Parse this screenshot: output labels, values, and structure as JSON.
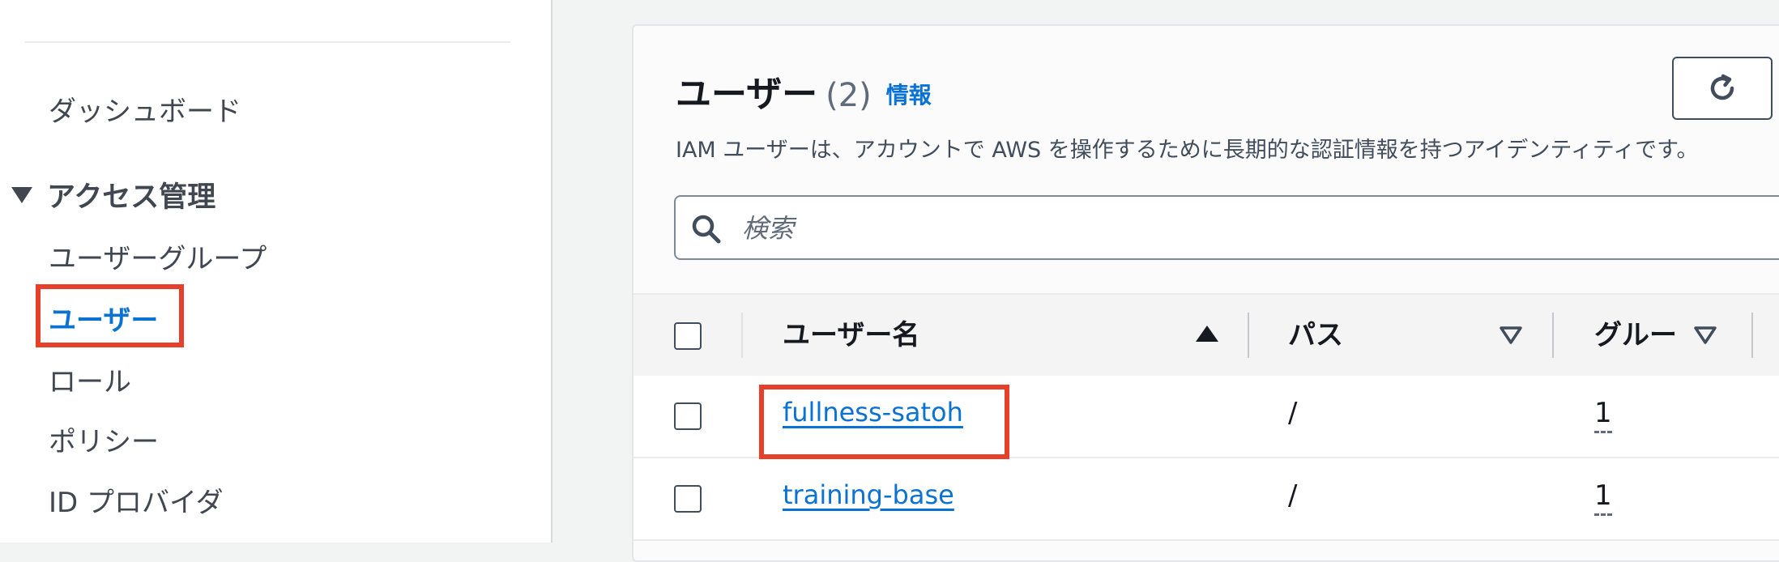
{
  "sidebar": {
    "dashboard": "ダッシュボード",
    "access_section": "アクセス管理",
    "items": [
      {
        "label": "ユーザーグループ"
      },
      {
        "label": "ユーザー"
      },
      {
        "label": "ロール"
      },
      {
        "label": "ポリシー"
      },
      {
        "label": "ID プロバイダ"
      }
    ],
    "active_item": "ユーザー"
  },
  "header": {
    "title": "ユーザー",
    "count": "(2)",
    "info_link": "情報",
    "description": "IAM ユーザーは、アカウントで AWS を操作するために長期的な認証情報を持つアイデンティティです。"
  },
  "toolbar": {
    "refresh_icon": "refresh-icon"
  },
  "search": {
    "placeholder": "検索"
  },
  "table": {
    "columns": [
      "ユーザー名",
      "パス",
      "グループ"
    ],
    "sort": {
      "column": "ユーザー名",
      "direction": "ascending"
    },
    "rows": [
      {
        "name": "fullness-satoh",
        "path": "/",
        "groups": "1"
      },
      {
        "name": "training-base",
        "path": "/",
        "groups": "1"
      }
    ]
  },
  "colors": {
    "accent": "#0972d3",
    "highlight": "#e7402a",
    "text": "#16191f"
  }
}
